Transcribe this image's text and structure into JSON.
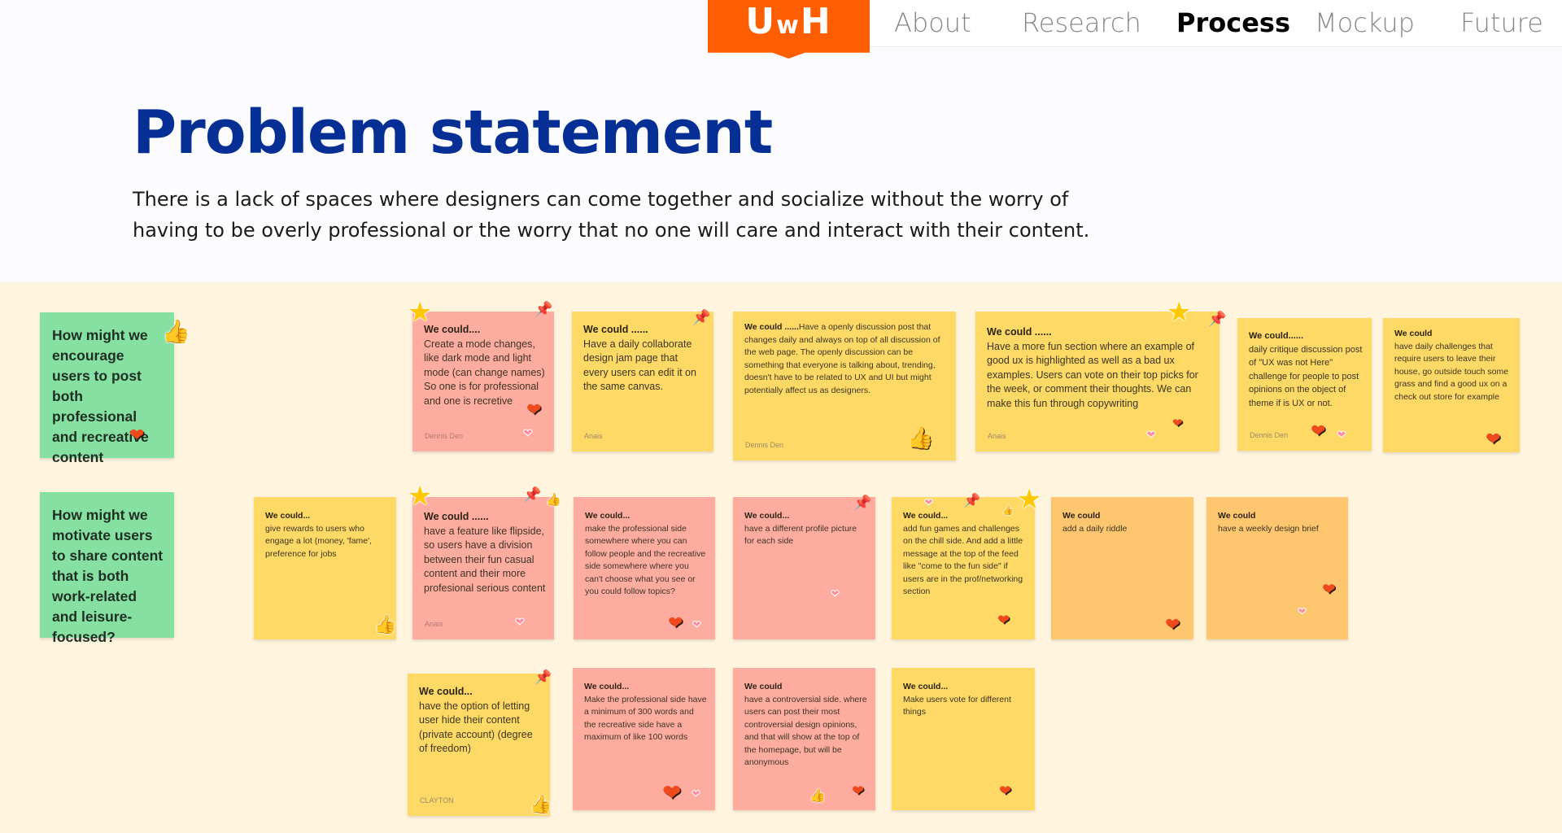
{
  "nav": {
    "logo": {
      "prefix": "U",
      "middle": "w",
      "suffix": "H"
    },
    "items": [
      {
        "label": "About",
        "active": false
      },
      {
        "label": "Research",
        "active": false
      },
      {
        "label": "Process",
        "active": true
      },
      {
        "label": "Mockup",
        "active": false
      },
      {
        "label": "Future",
        "active": false
      }
    ],
    "brand_color": "#ff5e00"
  },
  "section": {
    "title": "Problem statement",
    "title_color": "#062f96",
    "description_line1": "There is a lack of spaces where designers can come together and socialize without the worry of",
    "description_line2": "having to be overly professional or the worry that no one will care and interact with their content."
  },
  "board": {
    "hmw": [
      {
        "text": "How might we encourage users to post both professional and recreative content"
      },
      {
        "text": "How might we motivate users to share content that is both work-related and leisure-focused?"
      }
    ],
    "notes": [
      {
        "heading": "We could....",
        "text": "Create a mode changes, like dark mode and light mode (can change names) So one is for professional and one is recretive",
        "author": "Dennis Den"
      },
      {
        "heading": "We could ......",
        "text": "Have a daily collaborate design jam page that every users can edit it on the same canvas.",
        "author": "Anais"
      },
      {
        "heading": "We could ......",
        "text": "Have a openly discussion post that changes daily and always on top of all discussion of the web page. The openly discussion can be something that everyone is talking about, trending, doesn't have to be related to UX and UI but might potentially affect us as designers.",
        "author": "Dennis Den"
      },
      {
        "heading": "We could ......",
        "text": "Have a more fun section where an  example of good ux is highlighted as well as a bad ux examples. Users can vote on their top picks for the week, or comment their thoughts. We can make this fun through copywriting",
        "author": "Anais"
      },
      {
        "heading": "We could......",
        "text": "daily critique discussion post of \"UX was not Here\" challenge for people to post opinions on the object of theme if is UX or not.",
        "author": "Dennis Den"
      },
      {
        "heading": "We could",
        "text": "have daily challenges that require users to leave their house, go outside touch some grass and find a good ux on a check out store for example",
        "author": ""
      },
      {
        "heading": "We could...",
        "text": "give rewards to users who engage a lot (money, 'fame', preference for jobs",
        "author": ""
      },
      {
        "heading": "We could ......",
        "text": "have a feature like flipside, so users have a division between their fun casual content and their more profesional serious content",
        "author": "Anais"
      },
      {
        "heading": "We could...",
        "text": "make the professional side somewhere where you can follow people and the recreative side somewhere where you can't choose what you see or you could follow topics?",
        "author": ""
      },
      {
        "heading": "We could...",
        "text": "have a different profile picture for each side",
        "author": ""
      },
      {
        "heading": "We could...",
        "text": "add fun games and challenges on the chill side. And add a little message at the top of the feed like \"come to the fun side\" if users are in the prof/networking section",
        "author": ""
      },
      {
        "heading": "We could",
        "text": "add a daily riddle",
        "author": ""
      },
      {
        "heading": "We could",
        "text": "have a weekly design brief",
        "author": ""
      },
      {
        "heading": "We could...",
        "text": "have the option of letting user hide their content (private account) (degree of freedom)",
        "author": "CLAYTON"
      },
      {
        "heading": "We could...",
        "text": "Make the professional side have a minimum of 300 words and the recreative side have a maximum of like 100 words",
        "author": ""
      },
      {
        "heading": "We could",
        "text": "have a controversial side. where users can post their most controversial design opinions, and that will show at the top of the homepage, but will be anonymous",
        "author": ""
      },
      {
        "heading": "We could...",
        "text": "Make users vote for different things",
        "author": ""
      }
    ],
    "icons": {
      "heart": "❤",
      "star": "★",
      "thumb": "👍",
      "pin": "📌"
    },
    "colors": {
      "green": "#86e0a2",
      "pink": "#ffaca0",
      "yellow": "#ffd966",
      "orange": "#ffc670",
      "board": "#fff5df"
    }
  }
}
